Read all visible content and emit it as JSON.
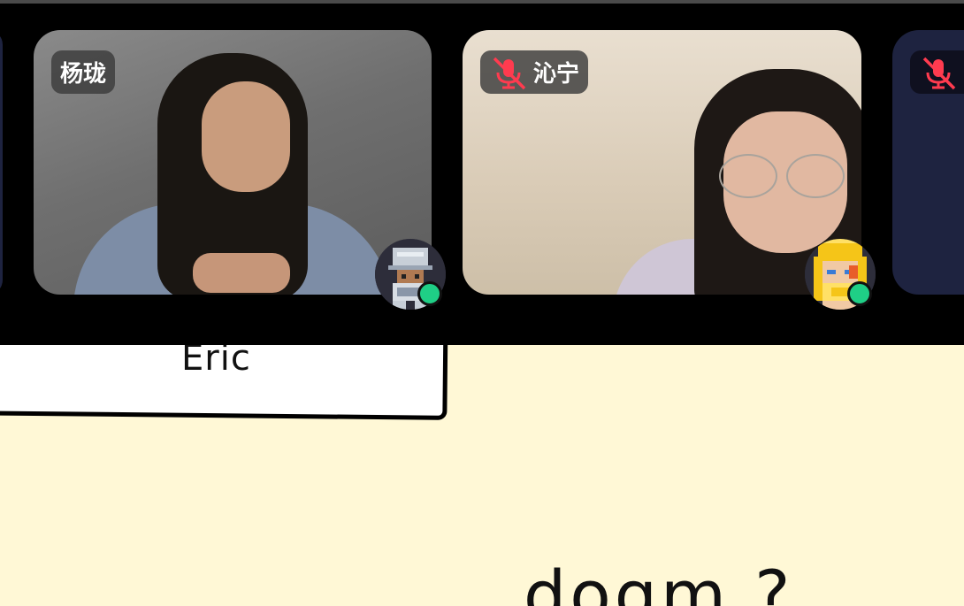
{
  "participants": [
    {
      "name": "杨珑",
      "muted": false,
      "status": "online",
      "avatar_icon": "pixel-knight-avatar"
    },
    {
      "name": "沁宁",
      "muted": true,
      "status": "online",
      "avatar_icon": "pixel-blonde-avatar"
    },
    {
      "name": "",
      "muted": true,
      "status": "camera-off"
    }
  ],
  "canvas": {
    "card_label": "Eric",
    "handwritten_text": "dogm ?"
  },
  "colors": {
    "canvas_background": "#fff8d6",
    "video_strip": "#000000",
    "online_dot": "#1fcf86",
    "mic_off": "#ff3b4f"
  }
}
